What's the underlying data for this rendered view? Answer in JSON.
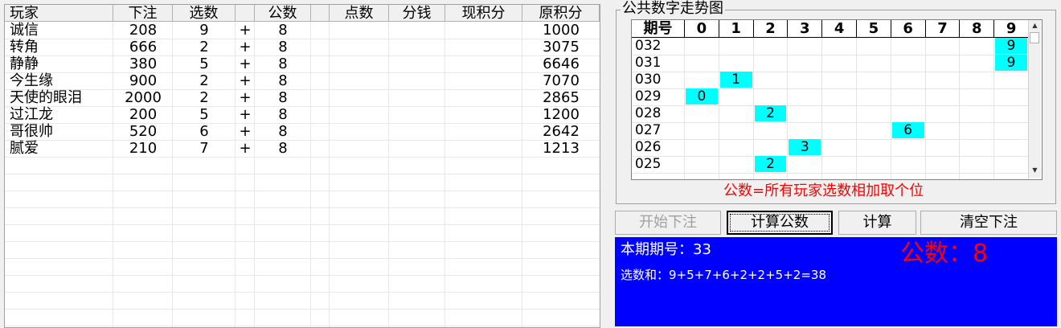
{
  "players": {
    "columns": [
      "玩家",
      "下注",
      "选数",
      "",
      "公数",
      "",
      "点数",
      "分钱",
      "现积分",
      "原积分"
    ],
    "rows": [
      {
        "name": "诚信",
        "bet": "208",
        "pick": "9",
        "op": "+",
        "common": "8",
        "orig": "1000"
      },
      {
        "name": "转角",
        "bet": "666",
        "pick": "2",
        "op": "+",
        "common": "8",
        "orig": "3075"
      },
      {
        "name": "静静",
        "bet": "380",
        "pick": "5",
        "op": "+",
        "common": "8",
        "orig": "6646"
      },
      {
        "name": "今生缘",
        "bet": "900",
        "pick": "2",
        "op": "+",
        "common": "8",
        "orig": "7070"
      },
      {
        "name": "天使的眼泪",
        "bet": "2000",
        "pick": "2",
        "op": "+",
        "common": "8",
        "orig": "2865"
      },
      {
        "name": "过江龙",
        "bet": "200",
        "pick": "5",
        "op": "+",
        "common": "8",
        "orig": "1200"
      },
      {
        "name": "哥很帅",
        "bet": "520",
        "pick": "6",
        "op": "+",
        "common": "8",
        "orig": "2642"
      },
      {
        "name": "腻爱",
        "bet": "210",
        "pick": "7",
        "op": "+",
        "common": "8",
        "orig": "1213"
      }
    ]
  },
  "trend": {
    "title": "公共数字走势图",
    "header_period": "期号",
    "digits": [
      "0",
      "1",
      "2",
      "3",
      "4",
      "5",
      "6",
      "7",
      "8",
      "9"
    ],
    "rows": [
      {
        "period": "032",
        "value": 9
      },
      {
        "period": "031",
        "value": 9
      },
      {
        "period": "030",
        "value": 1
      },
      {
        "period": "029",
        "value": 0
      },
      {
        "period": "028",
        "value": 2
      },
      {
        "period": "027",
        "value": 6
      },
      {
        "period": "026",
        "value": 3
      },
      {
        "period": "025",
        "value": 2
      }
    ],
    "formula": "公数=所有玩家选数相加取个位"
  },
  "buttons": {
    "start": "开始下注",
    "calc_common": "计算公数",
    "calc": "计算",
    "clear": "清空下注"
  },
  "info": {
    "period": "本期期号：33",
    "sum": "选数和：9+5+7+6+2+2+5+2=38",
    "common": "公数：8"
  },
  "colors": {
    "highlight": "#00ffff",
    "panel": "#0000ff",
    "accent_red": "#ff0000"
  }
}
